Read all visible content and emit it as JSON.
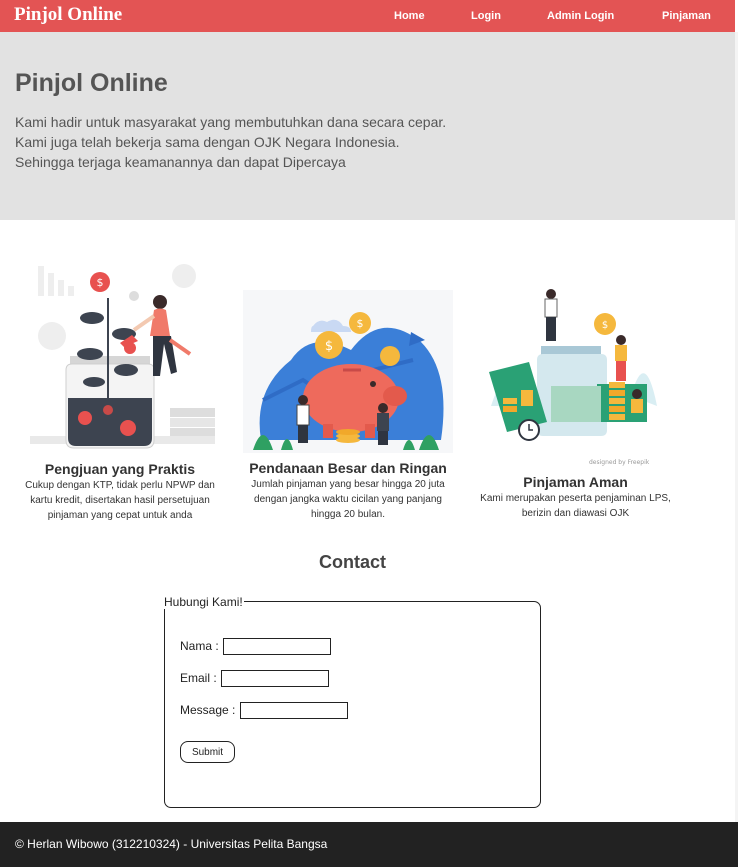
{
  "navbar": {
    "brand": "Pinjol Online",
    "links": [
      "Home",
      "Login",
      "Admin Login",
      "Pinjaman"
    ]
  },
  "hero": {
    "title": "Pinjol Online",
    "lines": [
      "Kami hadir untuk masyarakat yang membutuhkan dana secara cepar.",
      "Kami juga telah bekerja sama dengan OJK Negara Indonesia.",
      "Sehingga terjaga keamanannya dan dapat Dipercaya"
    ]
  },
  "features": [
    {
      "title": "Pengjuan yang Praktis",
      "desc": "Cukup dengan KTP, tidak perlu NPWP dan kartu kredit, disertakan hasil persetujuan pinjaman yang cepat untuk anda",
      "icon": "plant-jar-illustration"
    },
    {
      "title": "Pendanaan Besar dan Ringan",
      "desc": "Jumlah pinjaman yang besar hingga 20 juta dengan jangka waktu cicilan yang panjang hingga 20 bulan.",
      "icon": "piggy-bank-illustration"
    },
    {
      "title": "Pinjaman Aman",
      "desc": "Kami merupakan peserta penjaminan LPS, berizin dan diawasi OJK",
      "icon": "money-jar-illustration",
      "credit": "designed by Freepik"
    }
  ],
  "contact": {
    "title": "Contact",
    "legend": "Hubungi Kami!",
    "fields": [
      {
        "label": "Nama :",
        "value": ""
      },
      {
        "label": "Email :",
        "value": ""
      },
      {
        "label": "Message :",
        "value": ""
      }
    ],
    "submit_label": "Submit"
  },
  "footer": {
    "text": "© Herlan Wibowo (312210324) - Universitas Pelita Bangsa"
  },
  "colors": {
    "navbar": "#e35454",
    "hero_bg": "#e2e2e2",
    "footer_bg": "#222222",
    "accent_red": "#e8514f",
    "accent_blue": "#3b7fd8",
    "accent_gold": "#f5b83d"
  }
}
